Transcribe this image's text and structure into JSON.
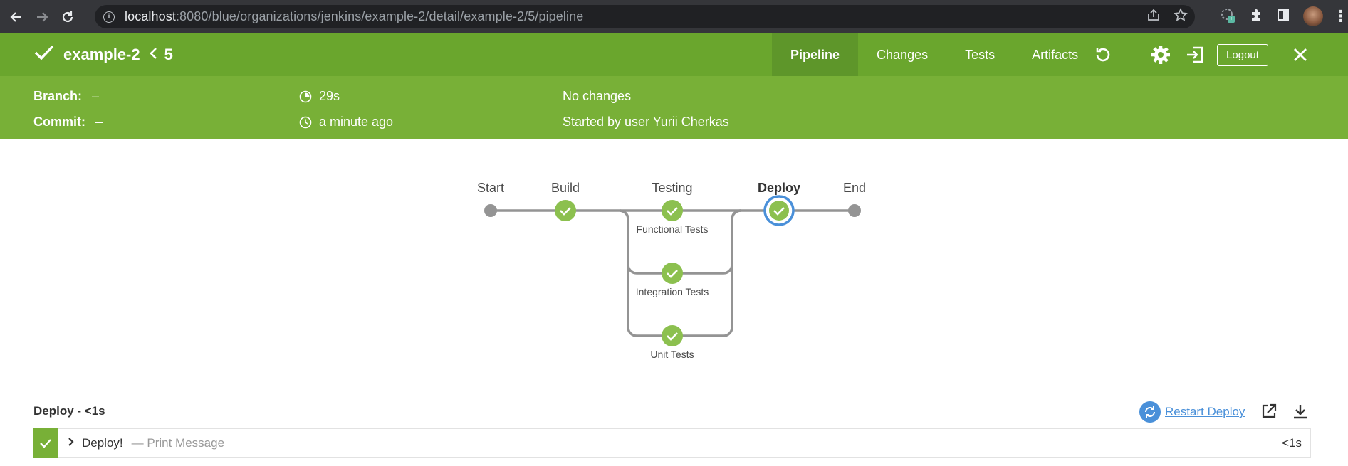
{
  "browser": {
    "url_host": "localhost",
    "url_path": ":8080/blue/organizations/jenkins/example-2/detail/example-2/5/pipeline"
  },
  "header": {
    "job_name": "example-2",
    "run_number": "5",
    "tabs": [
      {
        "label": "Pipeline",
        "active": true
      },
      {
        "label": "Changes",
        "active": false
      },
      {
        "label": "Tests",
        "active": false
      },
      {
        "label": "Artifacts",
        "active": false
      }
    ],
    "logout_label": "Logout",
    "color": "#6aa62d"
  },
  "info": {
    "branch_label": "Branch:",
    "branch_value": "–",
    "commit_label": "Commit:",
    "commit_value": "–",
    "duration": "29s",
    "time_ago": "a minute ago",
    "changes": "No changes",
    "started_by": "Started by user Yurii Cherkas"
  },
  "pipeline": {
    "stages": [
      {
        "label": "Start"
      },
      {
        "label": "Build"
      },
      {
        "label": "Testing"
      },
      {
        "label": "Deploy",
        "selected": true
      },
      {
        "label": "End"
      }
    ],
    "parallel_branches": [
      {
        "label": "Functional Tests"
      },
      {
        "label": "Integration Tests"
      },
      {
        "label": "Unit Tests"
      }
    ],
    "success_color": "#8cc04f",
    "selected_ring_color": "#4a90d9"
  },
  "step_panel": {
    "title": "Deploy - <1s",
    "restart_label": "Restart Deploy",
    "steps": [
      {
        "name": "Deploy!",
        "description": "— Print Message",
        "duration": "<1s"
      }
    ]
  }
}
